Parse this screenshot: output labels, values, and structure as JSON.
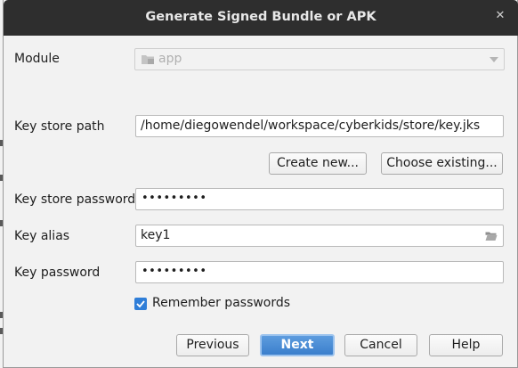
{
  "window": {
    "title": "Generate Signed Bundle or APK"
  },
  "icons": {
    "close": "close-icon",
    "module": "folder-module-icon",
    "dropdown": "chevron-down-icon",
    "browse": "folder-open-icon",
    "check": "checkmark-icon"
  },
  "colors": {
    "titlebar": "#2e2e2e",
    "accent": "#3b7fcc",
    "checkbox": "#2f7ed8"
  },
  "module": {
    "label": "Module",
    "value": "app",
    "disabled": true
  },
  "key_store_path": {
    "label": "Key store path",
    "value": "/home/diegowendel/workspace/cyberkids/store/key.jks"
  },
  "buttons": {
    "create_new": "Create new...",
    "choose_existing": "Choose existing...",
    "previous": "Previous",
    "next": "Next",
    "cancel": "Cancel",
    "help": "Help"
  },
  "key_store_password": {
    "label": "Key store password",
    "masked_value": "•••••••••"
  },
  "key_alias": {
    "label": "Key alias",
    "value": "key1"
  },
  "key_password": {
    "label": "Key password",
    "masked_value": "•••••••••"
  },
  "remember": {
    "label": "Remember passwords",
    "checked": true
  }
}
